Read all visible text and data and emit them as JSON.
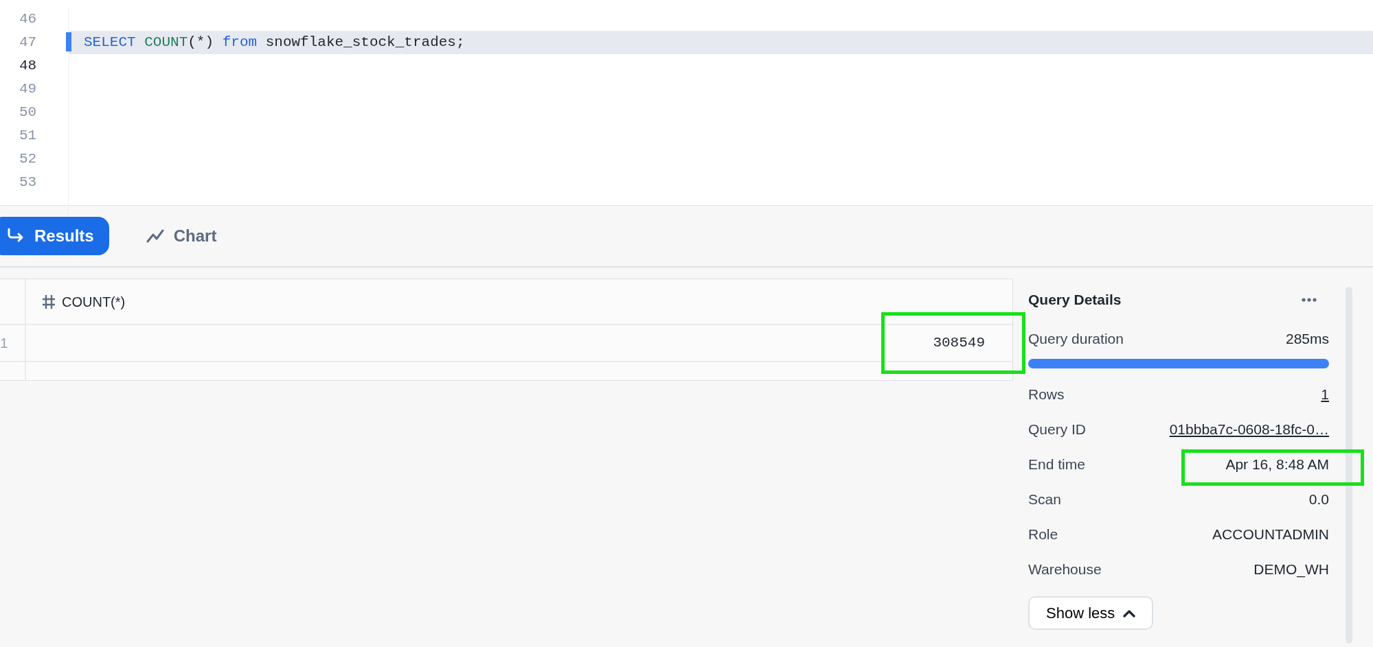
{
  "editor": {
    "lines": [
      {
        "number": "46",
        "selected": false,
        "current": false
      },
      {
        "number": "47",
        "selected": true,
        "current": false,
        "code": [
          {
            "kind": "keyword",
            "text": "SELECT"
          },
          {
            "kind": "function",
            "text": " COUNT"
          },
          {
            "kind": "plain",
            "text": "(*) "
          },
          {
            "kind": "keyword",
            "text": "from"
          },
          {
            "kind": "plain",
            "text": " snowflake_stock_trades;"
          }
        ]
      },
      {
        "number": "48",
        "selected": false,
        "current": true
      },
      {
        "number": "49",
        "selected": false,
        "current": false
      },
      {
        "number": "50",
        "selected": false,
        "current": false
      },
      {
        "number": "51",
        "selected": false,
        "current": false
      },
      {
        "number": "52",
        "selected": false,
        "current": false
      },
      {
        "number": "53",
        "selected": false,
        "current": false
      }
    ]
  },
  "tabs": [
    {
      "label": "Results",
      "kind": "results",
      "selected": true
    },
    {
      "label": "Chart",
      "kind": "chart",
      "selected": false
    }
  ],
  "table": {
    "columns": [
      {
        "label": "COUNT(*)",
        "kind": "number"
      }
    ],
    "rows": [
      {
        "number": "1",
        "cells": [
          "308549"
        ]
      }
    ]
  },
  "query_details": {
    "title": "Query Details",
    "duration": {
      "label": "Query duration",
      "value": "285ms",
      "level": 1
    },
    "items": [
      {
        "label": "Rows",
        "value": "1",
        "kind": "link"
      },
      {
        "label": "Query ID",
        "value": "01bbba7c-0608-18fc-0…",
        "kind": "link"
      },
      {
        "label": "End time",
        "value": "Apr 16, 8:48 AM",
        "kind": "text"
      },
      {
        "label": "Scan",
        "value": "0.0",
        "kind": "text"
      },
      {
        "label": "Role",
        "value": "ACCOUNTADMIN",
        "kind": "text"
      },
      {
        "label": "Warehouse",
        "value": "DEMO_WH",
        "kind": "text"
      }
    ],
    "button": "Show less"
  }
}
